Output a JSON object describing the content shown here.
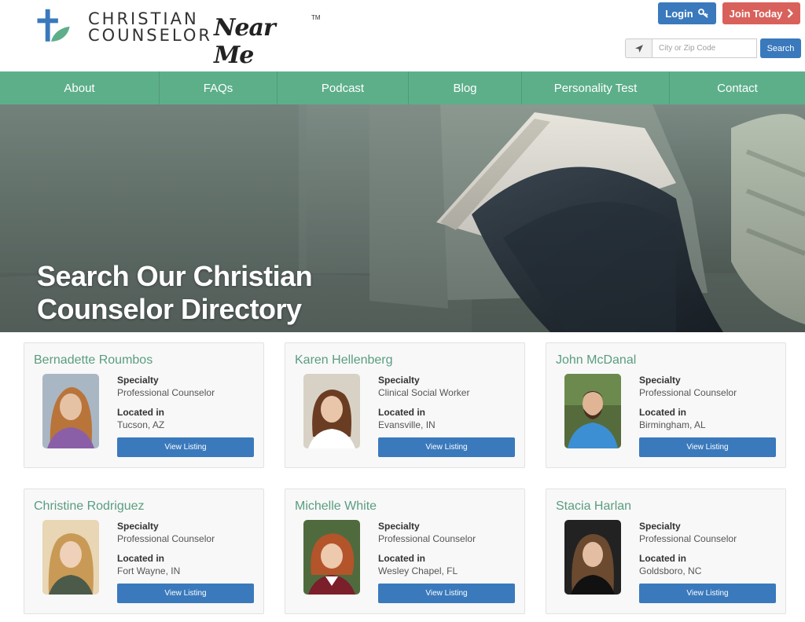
{
  "logo": {
    "line1": "CHRISTIAN",
    "line2": "COUNSELOR",
    "script": "Near Me",
    "tm": "TM"
  },
  "header": {
    "login_label": "Login",
    "join_label": "Join Today",
    "city_placeholder": "City or Zip Code",
    "search_label": "Search"
  },
  "nav": {
    "items": [
      "About",
      "FAQs",
      "Podcast",
      "Blog",
      "Personality Test",
      "Contact"
    ]
  },
  "hero": {
    "title": "Search Our Christian Counselor Directory"
  },
  "listings": [
    {
      "name": "Bernadette Roumbos",
      "specialty_label": "Specialty",
      "specialty": "Professional Counselor",
      "location_label": "Located in",
      "location": "Tucson, AZ",
      "button": "View Listing"
    },
    {
      "name": "Karen Hellenberg",
      "specialty_label": "Specialty",
      "specialty": "Clinical Social Worker",
      "location_label": "Located in",
      "location": "Evansville, IN",
      "button": "View Listing"
    },
    {
      "name": "John McDanal",
      "specialty_label": "Specialty",
      "specialty": "Professional Counselor",
      "location_label": "Located in",
      "location": "Birmingham, AL",
      "button": "View Listing"
    },
    {
      "name": "Christine Rodriguez",
      "specialty_label": "Specialty",
      "specialty": "Professional Counselor",
      "location_label": "Located in",
      "location": "Fort Wayne, IN",
      "button": "View Listing"
    },
    {
      "name": "Michelle White",
      "specialty_label": "Specialty",
      "specialty": "Professional Counselor",
      "location_label": "Located in",
      "location": "Wesley Chapel, FL",
      "button": "View Listing"
    },
    {
      "name": "Stacia Harlan",
      "specialty_label": "Specialty",
      "specialty": "Professional Counselor",
      "location_label": "Located in",
      "location": "Goldsboro, NC",
      "button": "View Listing"
    }
  ],
  "colors": {
    "brand_green": "#5daf8a",
    "brand_blue": "#3a79bc",
    "join_red": "#d9615c"
  },
  "icons": {
    "login": "key-icon",
    "join": "chevron-right-icon",
    "location": "location-arrow-icon"
  }
}
